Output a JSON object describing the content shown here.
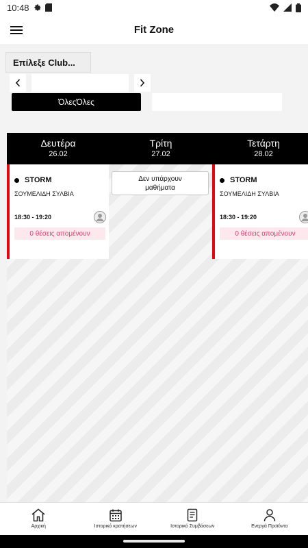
{
  "status_bar": {
    "time": "10:48",
    "left_icons": [
      "gear-icon",
      "sd-card-icon"
    ],
    "right_icons": [
      "wifi-icon",
      "signal-icon",
      "battery-icon"
    ]
  },
  "app_bar": {
    "title": "Fit Zone",
    "menu_icon": "hamburger-menu-icon"
  },
  "filters": {
    "club_select_label": "Επίλεξε Club...",
    "all_label": "ΌλεςΌλες",
    "second_label": ""
  },
  "schedule": {
    "days": [
      {
        "name": "Δευτέρα",
        "date": "26.02"
      },
      {
        "name": "Τρίτη",
        "date": "27.02"
      },
      {
        "name": "Τετάρτη",
        "date": "28.02"
      }
    ],
    "classes": [
      {
        "name": "STORM",
        "instructor": "ΣΟΥΜΕΛΙΔΗ ΣΥΛΒΙΑ",
        "time": "18:30 - 19:20",
        "spots": "0 θέσεις απομένουν"
      },
      {
        "name": "STORM",
        "instructor": "ΣΟΥΜΕΛΙΔΗ ΣΥΛΒΙΑ",
        "time": "18:30 - 19:20",
        "spots": "0 θέσεις απομένουν"
      }
    ],
    "no_classes_text": "Δεν υπάρχουν μαθήματα"
  },
  "bottom_nav": [
    {
      "label": "Αρχική",
      "icon": "home-icon"
    },
    {
      "label": "Ιστορικό κρατήσεων",
      "icon": "calendar-icon"
    },
    {
      "label": "Ιστορικό Συμβάσεων",
      "icon": "document-icon"
    },
    {
      "label": "Ενεργά Προϊόντα",
      "icon": "person-icon"
    }
  ],
  "colors": {
    "accent_red": "#e30613",
    "spots_text": "#e63b6f",
    "spots_bg": "#fde8ee",
    "header_black": "#000000"
  }
}
